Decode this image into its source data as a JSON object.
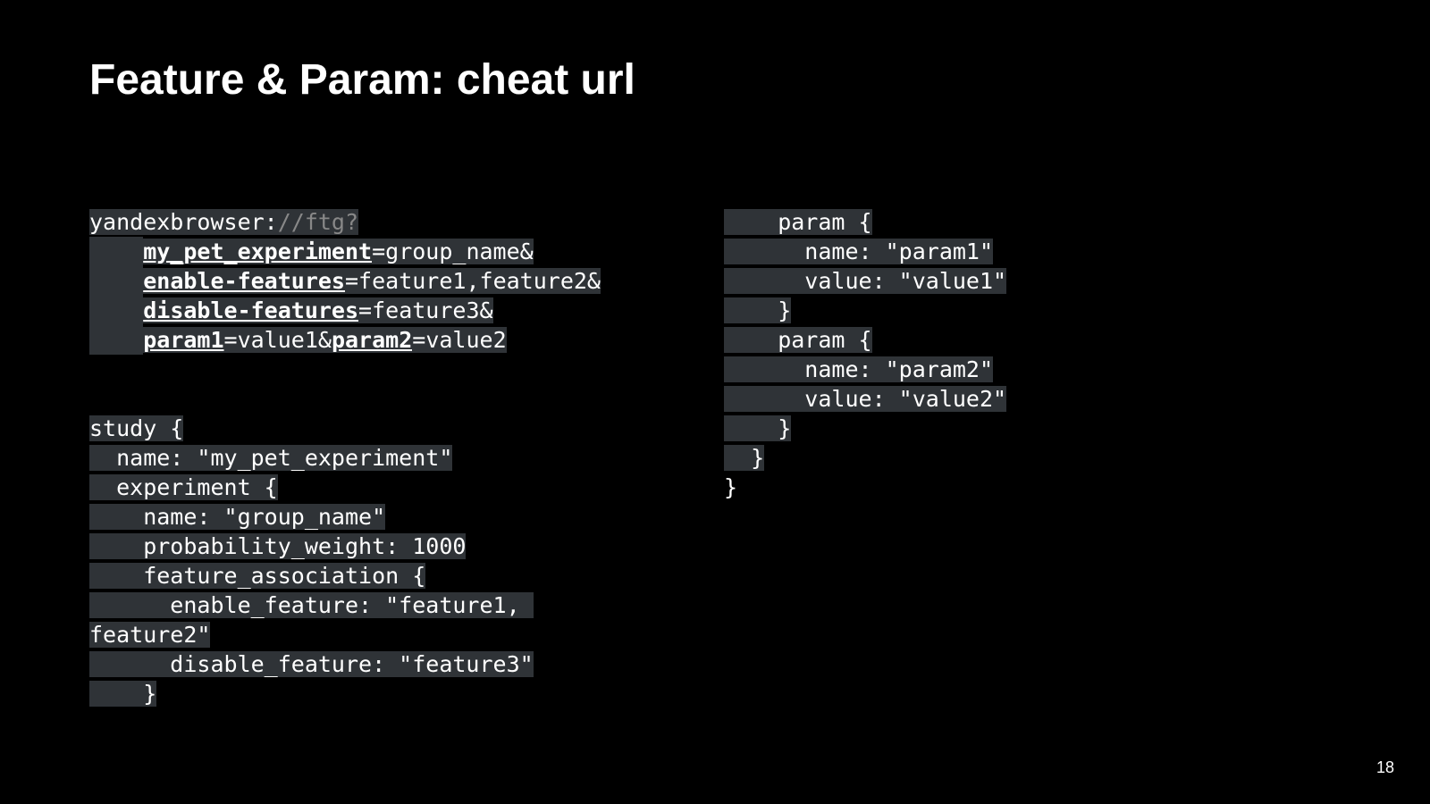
{
  "title": "Feature & Param: cheat url",
  "page": "18",
  "url": {
    "scheme": "yandexbrowser:",
    "path": "//ftg?",
    "l1_pad": "    ",
    "l1_key": "my_pet_experiment",
    "l1_rest": "=group_name&",
    "l2_pad": "    ",
    "l2_key": "enable-features",
    "l2_rest": "=feature1,feature2&",
    "l3_pad": "    ",
    "l3_key": "disable-features",
    "l3_rest": "=feature3&",
    "l4_pad": "    ",
    "l4_key1": "param1",
    "l4_mid": "=value1&",
    "l4_key2": "param2",
    "l4_rest": "=value2"
  },
  "left": {
    "l0": "study {",
    "l1": "  name: \"my_pet_experiment\"",
    "l2": "  experiment {",
    "l3": "    name: \"group_name\"",
    "l4": "    probability_weight: 1000",
    "l5": "    feature_association {",
    "l6": "      enable_feature: \"feature1, ",
    "l6b": "feature2\"",
    "l7": "      disable_feature: \"feature3\"",
    "l8": "    }"
  },
  "right": {
    "l0": "    param {",
    "l1": "      name: \"param1\"",
    "l2": "      value: \"value1\"",
    "l3": "    }",
    "l4": "    param {",
    "l5": "      name: \"param2\"",
    "l6": "      value: \"value2\"",
    "l7": "    }",
    "l8": "  }",
    "l9": "}"
  }
}
